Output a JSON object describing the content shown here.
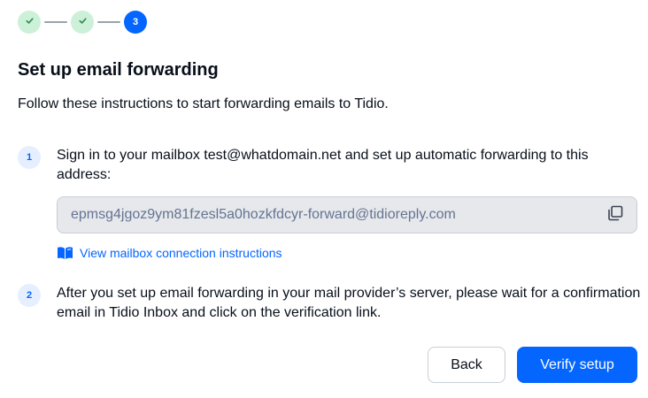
{
  "stepper": {
    "steps": [
      {
        "state": "completed",
        "icon": "check-icon"
      },
      {
        "state": "completed",
        "icon": "check-icon"
      },
      {
        "state": "active",
        "label": "3"
      }
    ]
  },
  "header": {
    "title": "Set up email forwarding",
    "subtitle": "Follow these instructions to start forwarding emails to Tidio."
  },
  "instructions": [
    {
      "number": "1",
      "text": "Sign in to your mailbox test@whatdomain.net and set up automatic forwarding to this address:"
    },
    {
      "number": "2",
      "text": "After you set up email forwarding in your mail provider’s server, please wait for a confirmation email in Tidio Inbox and click on the verification link."
    }
  ],
  "forwarding": {
    "address": "epmsg4jgoz9ym81fzesl5a0hozkfdcyr-forward@tidioreply.com",
    "copy_icon": "copy-icon"
  },
  "help_link": {
    "label": "View mailbox connection instructions",
    "icon": "book-icon"
  },
  "actions": {
    "back_label": "Back",
    "verify_label": "Verify setup"
  },
  "colors": {
    "accent": "#0566ff",
    "completed_step_bg": "#cdf0d9",
    "completed_step_check": "#2f8a52",
    "number_badge_bg": "#e5efff",
    "input_bg": "#e6e8ec",
    "input_text": "#647491"
  }
}
